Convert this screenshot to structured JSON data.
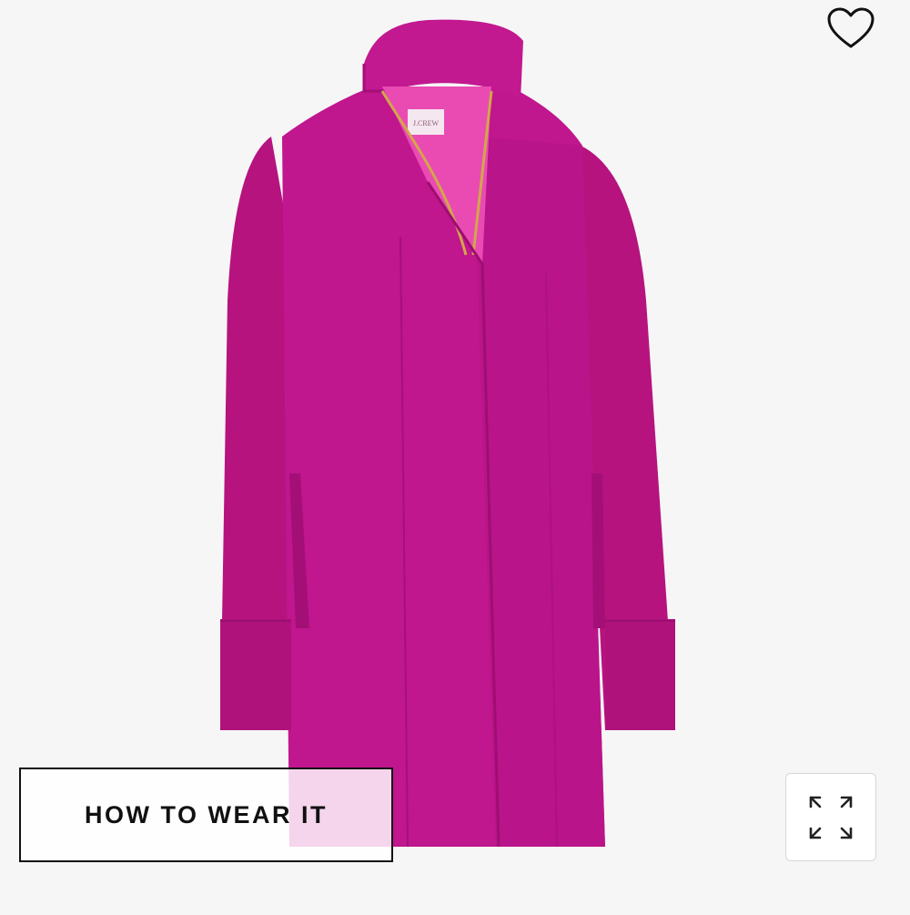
{
  "product": {
    "image_subject": "pink wool coat",
    "label_text": "J.CREW"
  },
  "actions": {
    "favorite_icon": "heart-outline-icon",
    "how_to_wear_label": "HOW TO WEAR IT",
    "expand_icon": "expand-arrows-icon"
  },
  "colors": {
    "background": "#f6f6f6",
    "coat": "#c0168e",
    "button_border": "#111111"
  }
}
